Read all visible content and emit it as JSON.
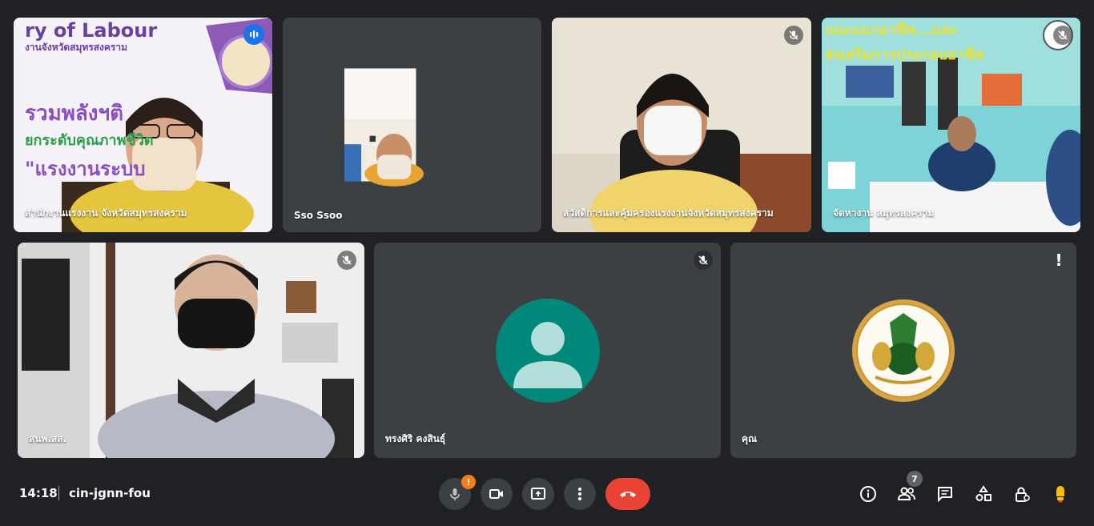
{
  "participants": [
    {
      "name": "สำนักงานแรงงาน จังหวัดสมุทรสงคราม",
      "status": "speaking"
    },
    {
      "name": "Sso Ssoo",
      "status": "none"
    },
    {
      "name": "สวัสดิการและคุ้มครองแรงงานจังหวัดสมุทรสงคราม",
      "status": "muted"
    },
    {
      "name": "จัดหางาน สมุทรสงคราม",
      "status": "muted"
    },
    {
      "name": "สนพ.สส.",
      "status": "muted"
    },
    {
      "name": "ทรงศิริ คงสินธุ์",
      "status": "muted"
    },
    {
      "name": "คุณ",
      "status": "warning"
    }
  ],
  "tile1_banner": {
    "line1": "ry of Labour",
    "line2": "งานจังหวัดสมุทรสงคราม",
    "line3": "รวมพลังฯติ",
    "line4": "ยกระดับคุณภาพชีวิต",
    "line5": "\"แรงงานระบบ"
  },
  "tile4_banner": {
    "line1": "แนะแนวอาชีพ...และ",
    "line2": "ส่งเสริมการประกอบอาชีพ"
  },
  "meeting": {
    "time": "14:18",
    "code": "cin-jgnn-fou",
    "mic_badge": "!",
    "participant_count": "7",
    "warning_mark": "!"
  },
  "colors": {
    "background": "#202124",
    "tile": "#3c4043",
    "active_border": "#8ab4f8",
    "end_call": "#ea4335",
    "avatar": "#00897b",
    "mic_badge": "#fa7b17"
  },
  "icons": [
    "mic-off-icon",
    "videocam-icon",
    "present-icon",
    "more-icon",
    "end-call-icon",
    "info-icon",
    "people-icon",
    "chat-icon",
    "activities-icon",
    "lock-person-icon",
    "raise-hand-icon"
  ]
}
